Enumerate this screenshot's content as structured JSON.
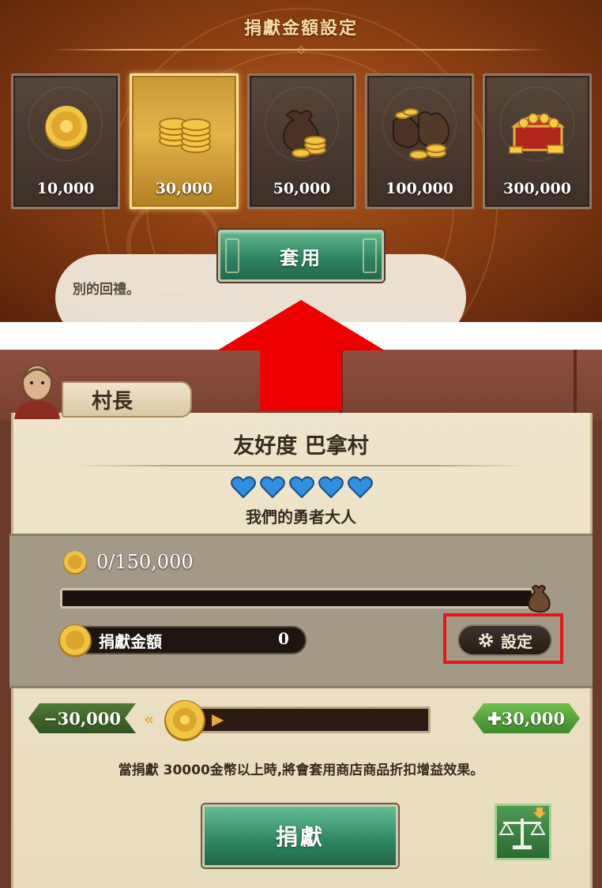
{
  "top_panel": {
    "title": "捐獻金額設定",
    "amounts": [
      {
        "label": "10,000",
        "icon": "single-coin-icon",
        "selected": false
      },
      {
        "label": "30,000",
        "icon": "coin-stack-icon",
        "selected": true
      },
      {
        "label": "50,000",
        "icon": "coin-bag-icon",
        "selected": false
      },
      {
        "label": "100,000",
        "icon": "coin-bags-icon",
        "selected": false
      },
      {
        "label": "300,000",
        "icon": "treasure-chest-icon",
        "selected": false
      }
    ],
    "apply_label": "套用",
    "background_text": "別的回禮。"
  },
  "annotation": {
    "arrow_color": "#ee0000",
    "highlight_color": "#e8141c"
  },
  "village": {
    "npc_name": "村長",
    "title": "友好度 巴拿村",
    "hearts_count": 5,
    "heart_color": "#2f8fe0",
    "rank": "我們的勇者大人",
    "progress_text": "0/150,000",
    "progress_fraction": 0,
    "donate_amount_label": "捐獻金額",
    "donate_amount_value": "0",
    "settings_label": "設定",
    "minus_label": "30,000",
    "plus_label": "30,000",
    "slider_fraction": 0,
    "info": "當捐獻 30000金幣以上時,將會套用商店商品折扣增益效果。",
    "donate_label": "捐獻"
  }
}
